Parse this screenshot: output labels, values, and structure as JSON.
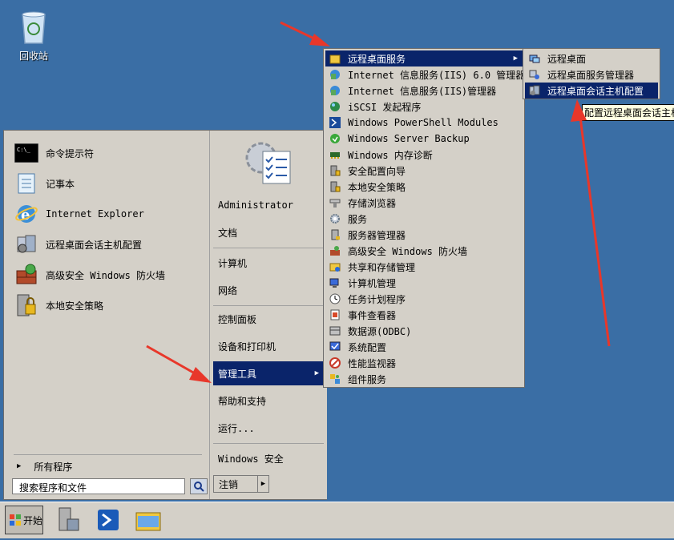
{
  "desktop": {
    "recycle_bin_label": "回收站"
  },
  "start_menu": {
    "pinned": [
      {
        "label": "命令提示符",
        "icon": "cmd-icon"
      },
      {
        "label": "记事本",
        "icon": "notepad-icon"
      },
      {
        "label": "Internet Explorer",
        "icon": "ie-icon"
      },
      {
        "label": "远程桌面会话主机配置",
        "icon": "rds-config-icon"
      },
      {
        "label": "高级安全 Windows 防火墙",
        "icon": "firewall-icon"
      },
      {
        "label": "本地安全策略",
        "icon": "security-policy-icon"
      }
    ],
    "all_programs": "所有程序",
    "search_placeholder": "搜索程序和文件",
    "right": {
      "user": "Administrator",
      "documents": "文档",
      "computer": "计算机",
      "network": "网络",
      "control_panel": "控制面板",
      "devices": "设备和打印机",
      "admin_tools": "管理工具",
      "help": "帮助和支持",
      "run": "运行...",
      "windows_security": "Windows 安全"
    },
    "logoff": "注销"
  },
  "admin_tools_menu": [
    "远程桌面服务",
    "Internet 信息服务(IIS) 6.0 管理器",
    "Internet 信息服务(IIS)管理器",
    "iSCSI 发起程序",
    "Windows PowerShell Modules",
    "Windows Server Backup",
    "Windows 内存诊断",
    "安全配置向导",
    "本地安全策略",
    "存储浏览器",
    "服务",
    "服务器管理器",
    "高级安全 Windows 防火墙",
    "共享和存储管理",
    "计算机管理",
    "任务计划程序",
    "事件查看器",
    "数据源(ODBC)",
    "系统配置",
    "性能监视器",
    "组件服务"
  ],
  "rds_menu": [
    "远程桌面",
    "远程桌面服务管理器",
    "远程桌面会话主机配置"
  ],
  "tooltip": "配置远程桌面会话主机",
  "taskbar": {
    "start": "开始"
  }
}
